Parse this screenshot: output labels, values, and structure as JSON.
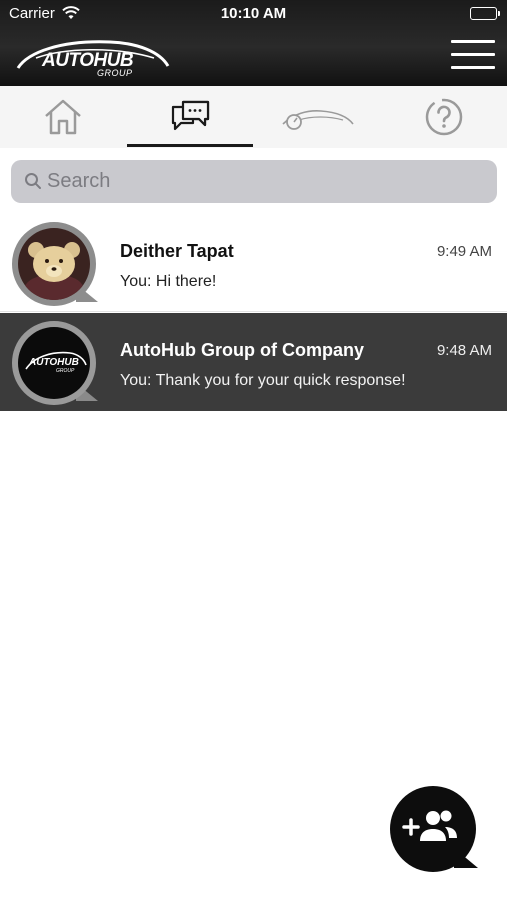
{
  "status_bar": {
    "carrier": "Carrier",
    "time": "10:10 AM"
  },
  "header": {
    "logo_text": "AUTOHUB",
    "logo_subtext": "GROUP",
    "menu_icon": "hamburger-menu-icon"
  },
  "tabs": [
    {
      "icon": "home-icon",
      "active": false
    },
    {
      "icon": "chat-bubbles-icon",
      "active": true
    },
    {
      "icon": "car-speedometer-icon",
      "active": false
    },
    {
      "icon": "help-question-icon",
      "active": false
    }
  ],
  "search": {
    "placeholder": "Search",
    "value": ""
  },
  "conversations": [
    {
      "name": "Deither Tapat",
      "time": "9:49 AM",
      "preview": "You: Hi there!",
      "avatar": "teddy-bear-photo",
      "selected": false
    },
    {
      "name": "AutoHub Group of Company",
      "time": "9:48 AM",
      "preview": "You: Thank you for your quick response!",
      "avatar": "autohub-logo",
      "avatar_text": "AUTOHUB",
      "avatar_subtext": "GROUP",
      "selected": true
    }
  ],
  "fab": {
    "icon": "add-group-icon"
  },
  "colors": {
    "header_bg": "#1f1f1f",
    "tabbar_bg": "#f5f5f5",
    "search_bg": "#c9c9ce",
    "selected_row_bg": "#3b3b3b",
    "fab_bg": "#0d0d0d"
  }
}
